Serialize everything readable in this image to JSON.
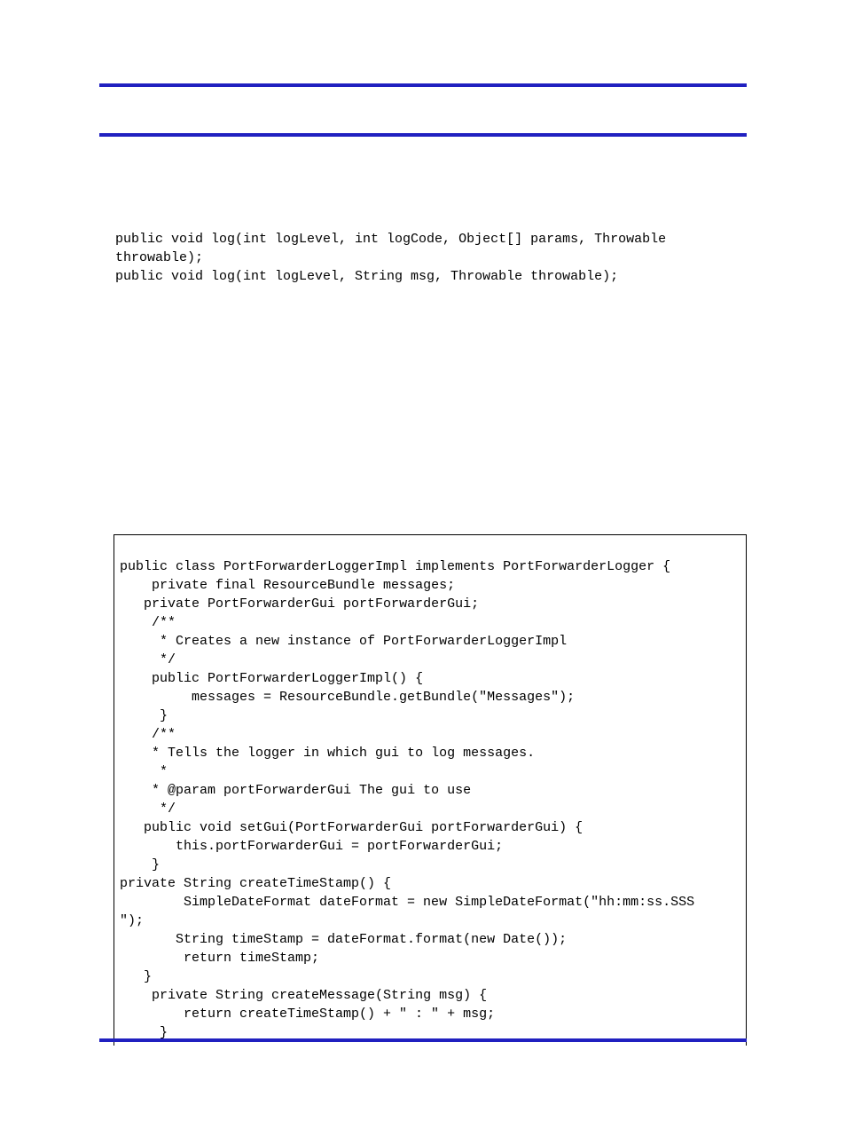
{
  "signatures": {
    "line1": "public void log(int logLevel, int logCode, Object[] params, Throwable",
    "line2": "throwable);",
    "line3": "public void log(int logLevel, String msg, Throwable throwable);"
  },
  "code": {
    "l1": "public class PortForwarderLoggerImpl implements PortForwarderLogger {",
    "l2": "    private final ResourceBundle messages;",
    "l3": "   private PortForwarderGui portForwarderGui;",
    "l4": "    /**",
    "l5": "     * Creates a new instance of PortForwarderLoggerImpl",
    "l6": "     */",
    "l7": "    public PortForwarderLoggerImpl() {",
    "l8": "         messages = ResourceBundle.getBundle(\"Messages\");",
    "l9": "     }",
    "l10": "    /**",
    "l11": "    * Tells the logger in which gui to log messages.",
    "l12": "     *",
    "l13": "    * @param portForwarderGui The gui to use",
    "l14": "     */",
    "l15": "   public void setGui(PortForwarderGui portForwarderGui) {",
    "l16": "       this.portForwarderGui = portForwarderGui;",
    "l17": "    }",
    "l18": "private String createTimeStamp() {",
    "l19": "        SimpleDateFormat dateFormat = new SimpleDateFormat(\"hh:mm:ss.SSS",
    "l20": "\");",
    "l21": "       String timeStamp = dateFormat.format(new Date());",
    "l22": "        return timeStamp;",
    "l23": "   }",
    "l24": "    private String createMessage(String msg) {",
    "l25": "        return createTimeStamp() + \" : \" + msg;",
    "l26": "     }"
  }
}
